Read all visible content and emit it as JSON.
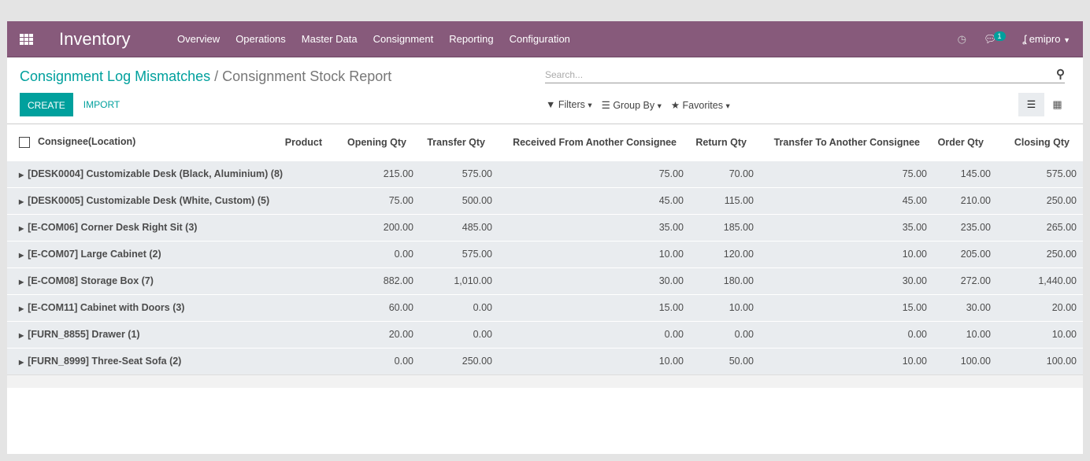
{
  "nav": {
    "app": "Inventory",
    "menu": [
      "Overview",
      "Operations",
      "Master Data",
      "Consignment",
      "Reporting",
      "Configuration"
    ],
    "messages_count": "1",
    "user": "emipro"
  },
  "breadcrumb": {
    "parent": "Consignment Log Mismatches",
    "separator": "/",
    "current": "Consignment Stock Report"
  },
  "buttons": {
    "create": "CREATE",
    "import": "IMPORT"
  },
  "search": {
    "placeholder": "Search..."
  },
  "filters": {
    "filters": "Filters",
    "group_by": "Group By",
    "favorites": "Favorites"
  },
  "table": {
    "columns": [
      "Consignee(Location)",
      "Product",
      "Opening Qty",
      "Transfer Qty",
      "Received From Another Consignee",
      "Return Qty",
      "Transfer To Another Consignee",
      "Order Qty",
      "Closing Qty"
    ],
    "rows": [
      [
        "[DESK0004] Customizable Desk (Black, Aluminium) (8)",
        "",
        "215.00",
        "575.00",
        "75.00",
        "70.00",
        "75.00",
        "145.00",
        "575.00"
      ],
      [
        "[DESK0005] Customizable Desk (White, Custom) (5)",
        "",
        "75.00",
        "500.00",
        "45.00",
        "115.00",
        "45.00",
        "210.00",
        "250.00"
      ],
      [
        "[E-COM06] Corner Desk Right Sit (3)",
        "",
        "200.00",
        "485.00",
        "35.00",
        "185.00",
        "35.00",
        "235.00",
        "265.00"
      ],
      [
        "[E-COM07] Large Cabinet (2)",
        "",
        "0.00",
        "575.00",
        "10.00",
        "120.00",
        "10.00",
        "205.00",
        "250.00"
      ],
      [
        "[E-COM08] Storage Box (7)",
        "",
        "882.00",
        "1,010.00",
        "30.00",
        "180.00",
        "30.00",
        "272.00",
        "1,440.00"
      ],
      [
        "[E-COM11] Cabinet with Doors (3)",
        "",
        "60.00",
        "0.00",
        "15.00",
        "10.00",
        "15.00",
        "30.00",
        "20.00"
      ],
      [
        "[FURN_8855] Drawer (1)",
        "",
        "20.00",
        "0.00",
        "0.00",
        "0.00",
        "0.00",
        "10.00",
        "10.00"
      ],
      [
        "[FURN_8999] Three-Seat Sofa (2)",
        "",
        "0.00",
        "250.00",
        "10.00",
        "50.00",
        "10.00",
        "100.00",
        "100.00"
      ]
    ]
  }
}
